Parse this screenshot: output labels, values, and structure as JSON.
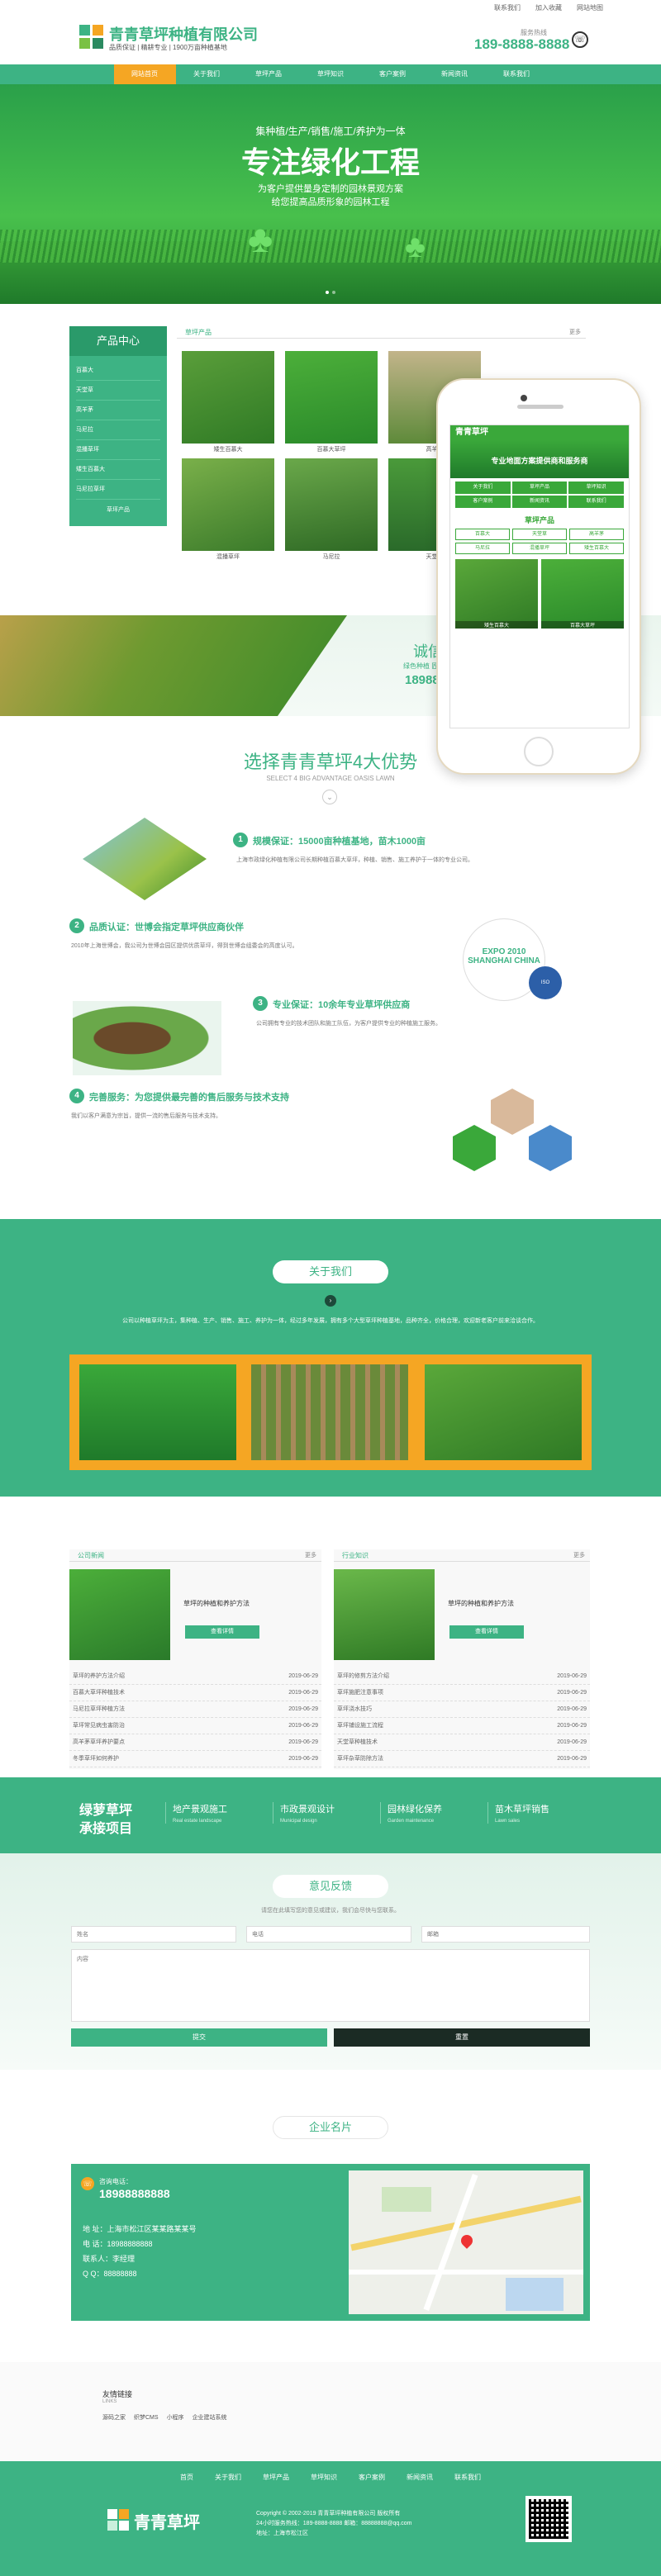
{
  "header": {
    "top_links": [
      "联系我们",
      "加入收藏",
      "网站地图"
    ],
    "company": "青青草坪种植有限公司",
    "slogan": "品质保证 | 精耕专业 | 1900万亩种植基地",
    "hotline_label": "服务热线",
    "hotline": "189-8888-8888"
  },
  "nav": [
    "网站首页",
    "关于我们",
    "草坪产品",
    "草坪知识",
    "客户案例",
    "新闻资讯",
    "联系我们"
  ],
  "banner": {
    "line1": "集种植/生产/销售/施工/养护为一体",
    "title": "专注绿化工程",
    "line2": "为客户提供量身定制的园林景观方案",
    "line3": "给您提高品质形象的园林工程"
  },
  "products": {
    "sidebar_title": "产品中心",
    "sidebar_items": [
      "百慕大",
      "天堂草",
      "高羊茅",
      "马尼拉",
      "混播草坪",
      "矮生百慕大",
      "马尼拉草坪"
    ],
    "sidebar_more": "草坪产品",
    "tab": "草坪产品",
    "more": "更多",
    "items": [
      "矮生百慕大",
      "百慕大草坪",
      "高羊茅",
      "马尼拉草坪",
      "混播草坪",
      "马尼拉",
      "天堂草",
      "果岭草坪"
    ]
  },
  "phone": {
    "brand": "青青草坪",
    "banner": "专业地面方案提供商和服务商",
    "menu": [
      "关于我们",
      "草坪产品",
      "草坪知识",
      "客户案例",
      "新闻资讯",
      "联系我们"
    ],
    "section": "草坪产品",
    "items": [
      "百慕大",
      "天堂草",
      "高羊茅",
      "马尼拉",
      "混播草坪",
      "矮生百慕大"
    ],
    "photo_labels": [
      "矮生百慕大",
      "百慕大草坪"
    ]
  },
  "trust": {
    "title": "诚信经营",
    "sub": "绿色种植 匠心服务",
    "phone": "18988888888"
  },
  "advantages": {
    "title": "选择青青草坪4大优势",
    "subtitle": "SELECT 4 BIG ADVANTAGE OASIS LAWN",
    "items": [
      {
        "num": "1",
        "head": "规模保证：",
        "text": "15000亩种植基地，苗木1000亩",
        "desc": "上海市政绿化种植有限公司长期种植百慕大草坪，种植、销售、施工养护于一体的专业公司。"
      },
      {
        "num": "2",
        "head": "品质认证：",
        "text": "世博会指定草坪供应商伙伴",
        "desc": "2010年上海世博会，我公司为世博会园区提供优质草坪，得到世博会组委会的高度认可。"
      },
      {
        "num": "3",
        "head": "专业保证：",
        "text": "10余年专业草坪供应商",
        "desc": "公司拥有专业的技术团队和施工队伍，为客户提供专业的种植施工服务。"
      },
      {
        "num": "4",
        "head": "完善服务：",
        "text": "为您提供最完善的售后服务与技术支持",
        "desc": "我们以客户满意为宗旨，提供一流的售后服务与技术支持。"
      }
    ],
    "expo": "EXPO 2010 SHANGHAI CHINA"
  },
  "about": {
    "title": "关于我们",
    "text": "公司以种植草坪为主，集种植、生产、销售、施工、养护为一体，经过多年发展，拥有多个大型草坪种植基地，品种齐全，价格合理，欢迎新老客户前来洽谈合作。"
  },
  "news": {
    "cols": [
      {
        "tab": "公司新闻",
        "more": "更多",
        "headline": "草坪的种植和养护方法",
        "btn": "查看详情",
        "rows": [
          [
            "草坪的养护方法介绍",
            "2019-06-29"
          ],
          [
            "百慕大草坪种植技术",
            "2019-06-29"
          ],
          [
            "马尼拉草坪种植方法",
            "2019-06-29"
          ],
          [
            "草坪常见病虫害防治",
            "2019-06-29"
          ],
          [
            "高羊茅草坪养护要点",
            "2019-06-29"
          ],
          [
            "冬季草坪如何养护",
            "2019-06-29"
          ]
        ]
      },
      {
        "tab": "行业知识",
        "more": "更多",
        "headline": "草坪的种植和养护方法",
        "btn": "查看详情",
        "rows": [
          [
            "草坪的修剪方法介绍",
            "2019-06-29"
          ],
          [
            "草坪施肥注意事项",
            "2019-06-29"
          ],
          [
            "草坪浇水技巧",
            "2019-06-29"
          ],
          [
            "草坪铺设施工流程",
            "2019-06-29"
          ],
          [
            "天堂草种植技术",
            "2019-06-29"
          ],
          [
            "草坪杂草防除方法",
            "2019-06-29"
          ]
        ]
      }
    ]
  },
  "services": {
    "title1": "绿萝草坪",
    "title2": "承接项目",
    "items": [
      "地产景观施工",
      "市政景观设计",
      "园林绿化保养",
      "苗木草坪销售"
    ],
    "subs": [
      "Real estate landscape",
      "Municipal design",
      "Garden maintenance",
      "Lawn sales"
    ]
  },
  "feedback": {
    "title": "意见反馈",
    "desc": "请您在此填写您的意见或建议，我们会尽快与您联系。",
    "ph_name": "姓名",
    "ph_phone": "电话",
    "ph_email": "邮箱",
    "ph_content": "内容",
    "submit": "提交",
    "reset": "重置"
  },
  "card": {
    "title": "企业名片",
    "hotline_label": "咨询电话：",
    "hotline": "18988888888",
    "addr": "地  址：上海市松江区某某路某某号",
    "phone": "电  话：18988888888",
    "contact": "联系人：李经理",
    "qq": "Q  Q：88888888"
  },
  "links": {
    "title": "友情链接",
    "sub": "LINKS",
    "items": [
      "源码之家",
      "织梦CMS",
      "小程序",
      "企业建站系统"
    ]
  },
  "footer": {
    "nav": [
      "首页",
      "关于我们",
      "草坪产品",
      "草坪知识",
      "客户案例",
      "新闻资讯",
      "联系我们"
    ],
    "brand": "青青草坪",
    "copy": "Copyright © 2002-2019 青青草坪种植有限公司 版权所有",
    "contact": "24小时服务热线：189-8888-8888  邮箱：88888888@qq.com",
    "addr": "地址：上海市松江区"
  }
}
